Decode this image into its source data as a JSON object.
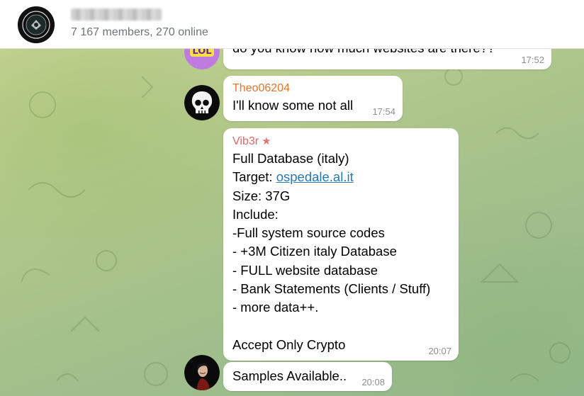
{
  "header": {
    "title": "",
    "subtitle": "7 167 members, 270 online"
  },
  "messages": [
    {
      "text": "do you know how much websites are there??",
      "time": "17:52",
      "avatar_icon": "lol-sticker-avatar"
    },
    {
      "sender": "Theo06204",
      "sender_color": "#e8732a",
      "text": "I'll know some not all",
      "time": "17:54",
      "avatar_icon": "skull-avatar"
    },
    {
      "sender": "Vib3r",
      "sender_color": "#e06666",
      "sender_badge_icon": "star-icon",
      "lines": [
        "Full Database (italy)",
        "Target: ",
        "Size: 37G",
        "Include:",
        "-Full system source codes",
        "- +3M Citizen italy Database",
        "- FULL website database",
        "- Bank Statements (Clients / Stuff)",
        "- more data++.",
        "",
        "Accept Only Crypto"
      ],
      "link": "ospedale.al.it",
      "time": "20:07"
    },
    {
      "text": "Samples Available..",
      "time": "20:08",
      "avatar_icon": "dark-figure-avatar"
    }
  ],
  "colors": {
    "header_bg": "#ffffff",
    "subtitle": "#707579",
    "link": "#2678b6",
    "time": "#8d8f90"
  }
}
